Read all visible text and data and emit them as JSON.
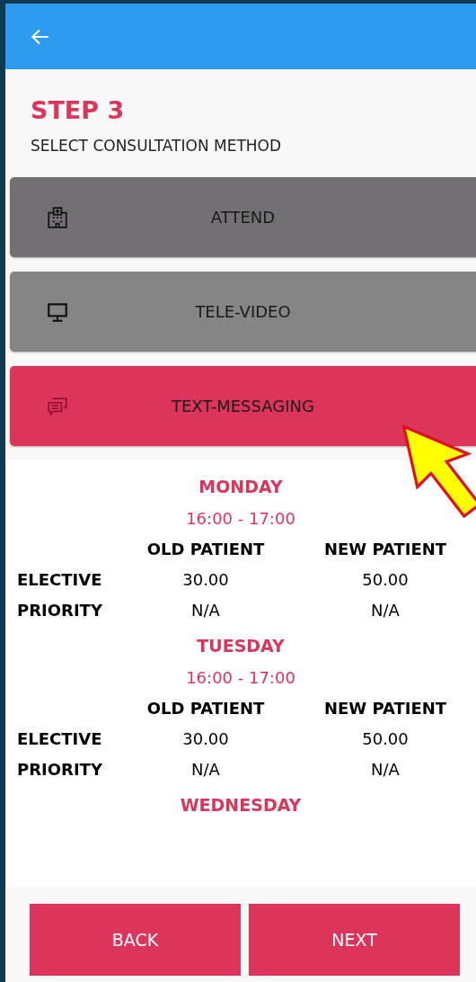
{
  "step": {
    "title": "STEP 3",
    "subtitle": "SELECT CONSULTATION METHOD"
  },
  "methods": [
    {
      "kind": "hospital",
      "label": "ATTEND",
      "selected": false,
      "color": "#737073"
    },
    {
      "kind": "monitor",
      "label": "TELE-VIDEO",
      "selected": false,
      "color": "#858585"
    },
    {
      "kind": "chat",
      "label": "TEXT-MESSAGING",
      "selected": true,
      "color": "#dc345a"
    }
  ],
  "schedule": [
    {
      "day": "MONDAY",
      "time": "16:00 - 17:00",
      "columns": [
        "OLD PATIENT",
        "NEW PATIENT"
      ],
      "rows": [
        {
          "label": "ELECTIVE",
          "values": [
            "30.00",
            "50.00"
          ]
        },
        {
          "label": "PRIORITY",
          "values": [
            "N/A",
            "N/A"
          ]
        }
      ]
    },
    {
      "day": "TUESDAY",
      "time": "16:00 - 17:00",
      "columns": [
        "OLD PATIENT",
        "NEW PATIENT"
      ],
      "rows": [
        {
          "label": "ELECTIVE",
          "values": [
            "30.00",
            "50.00"
          ]
        },
        {
          "label": "PRIORITY",
          "values": [
            "N/A",
            "N/A"
          ]
        }
      ]
    },
    {
      "day": "WEDNESDAY"
    }
  ],
  "footer": {
    "buttons": [
      "BACK",
      "NEXT"
    ]
  }
}
